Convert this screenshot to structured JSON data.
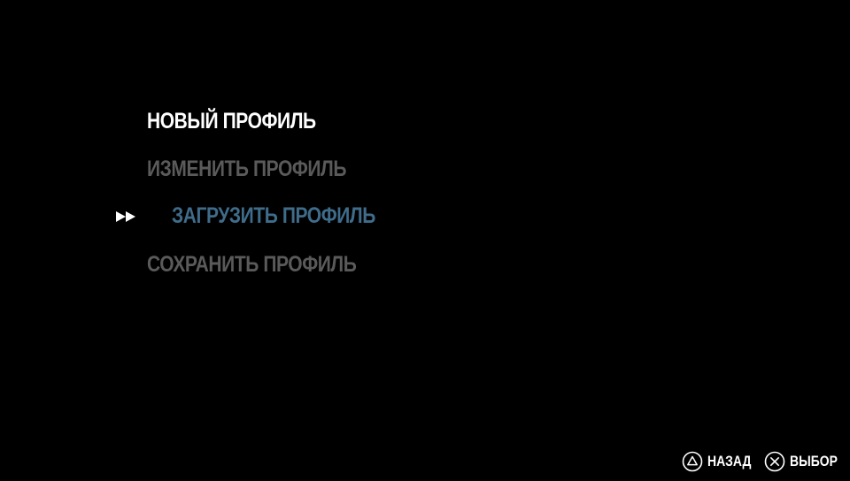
{
  "menu": {
    "items": [
      {
        "label": "НОВЫЙ ПРОФИЛЬ",
        "state": "highlighted",
        "color": "#ffffff"
      },
      {
        "label": "ИЗМЕНИТЬ ПРОФИЛЬ",
        "state": "disabled",
        "color": "#5a5a5a"
      },
      {
        "label": "ЗАГРУЗИТЬ ПРОФИЛЬ",
        "state": "selected",
        "color": "#3f6c8a"
      },
      {
        "label": "СОХРАНИТЬ ПРОФИЛЬ",
        "state": "disabled",
        "color": "#5a5a5a"
      }
    ],
    "cursor_icon": "double-arrow-right-icon"
  },
  "footer": {
    "back": {
      "icon": "triangle-button-icon",
      "label": "НАЗАД"
    },
    "select": {
      "icon": "cross-button-icon",
      "label": "ВЫБОР"
    }
  },
  "colors": {
    "background": "#000000",
    "text_active": "#ffffff",
    "text_disabled": "#5a5a5a",
    "text_selected": "#3f6c8a"
  }
}
